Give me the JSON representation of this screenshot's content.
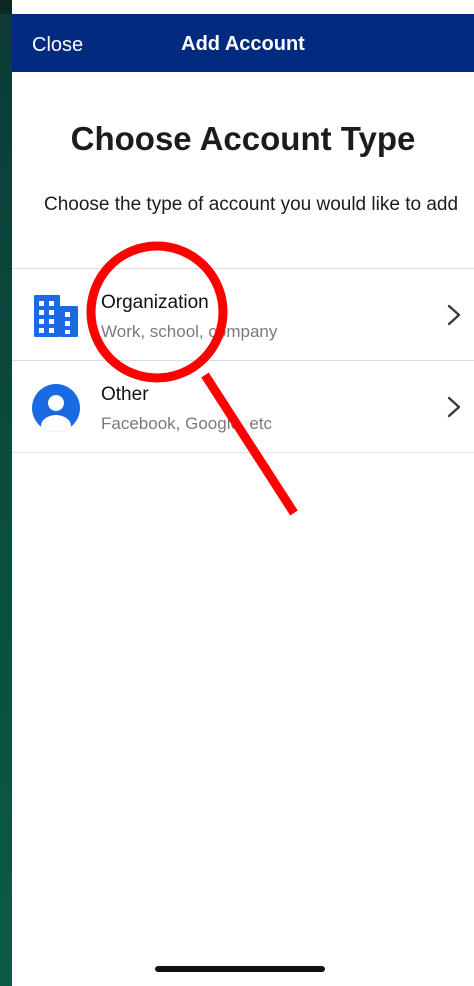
{
  "navbar": {
    "close_label": "Close",
    "title": "Add Account"
  },
  "page": {
    "heading": "Choose Account Type",
    "subtitle": "Choose the type of account you would like to add"
  },
  "account_types": [
    {
      "title": "Organization",
      "subtitle": "Work, school, company",
      "icon": "building-icon"
    },
    {
      "title": "Other",
      "subtitle": "Facebook, Google, etc",
      "icon": "person-icon"
    }
  ],
  "colors": {
    "navbar_bg": "#022a7f",
    "icon_blue": "#1a6ae3",
    "annotation_red": "#ff0000"
  }
}
